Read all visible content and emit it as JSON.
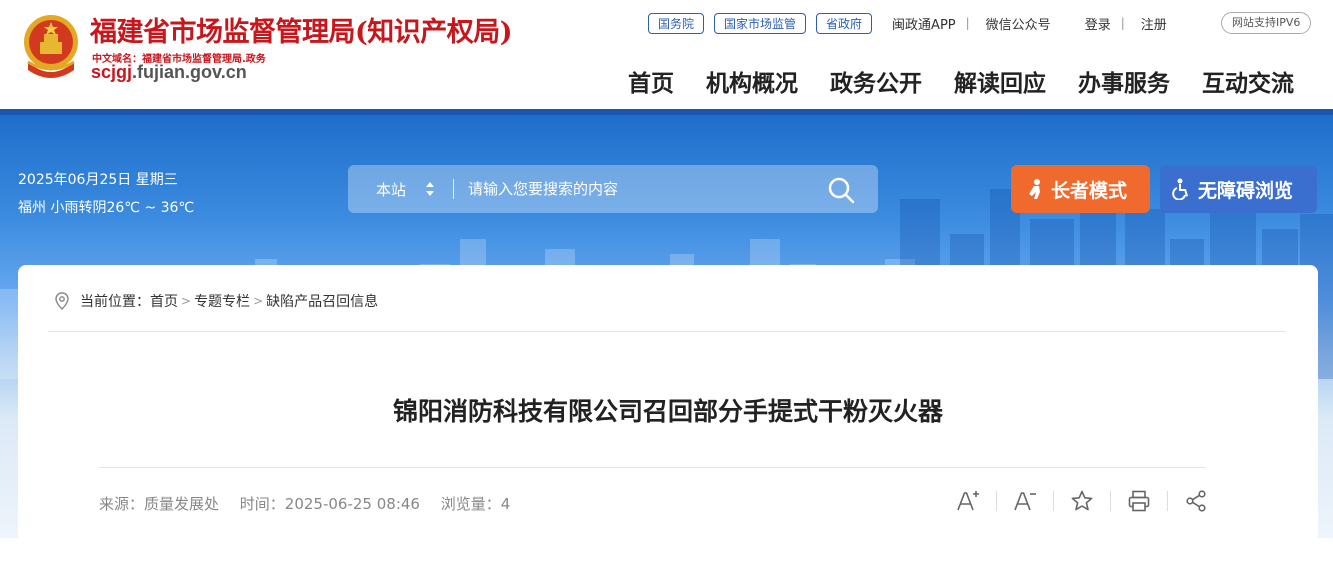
{
  "header": {
    "site_title": "福建省市场监督管理局(知识产权局)",
    "cn_domain": "中文域名：福建省市场监督管理局.政务",
    "en_domain_hl": "scjgj",
    "en_domain_rest": ".fujian.gov.cn",
    "top_pills": [
      "国务院",
      "国家市场监管",
      "省政府"
    ],
    "app_link": "闽政通APP",
    "wechat_link": "微信公众号",
    "login": "登录",
    "register": "注册",
    "ipv6_badge": "网站支持IPV6",
    "nav": [
      "首页",
      "机构概况",
      "政务公开",
      "解读回应",
      "办事服务",
      "互动交流"
    ]
  },
  "banner": {
    "date": "2025年06月25日 星期三",
    "weather": "福州 小雨转阴26℃ ~ 36℃",
    "search_scope": "本站",
    "search_placeholder": "请输入您要搜索的内容",
    "elder_mode": "长者模式",
    "accessible": "无障碍浏览"
  },
  "breadcrumb": {
    "label": "当前位置：",
    "items": [
      "首页",
      "专题专栏",
      "缺陷产品召回信息"
    ],
    "arrow": ">"
  },
  "article": {
    "title": "锦阳消防科技有限公司召回部分手提式干粉灭火器",
    "source": "来源：质量发展处",
    "time": "时间：2025-06-25 08:46",
    "views": "浏览量：4"
  },
  "colors": {
    "brand_red": "#c8161d",
    "nav_blue": "#2c5fb4",
    "elder_orange": "#ef6a2c",
    "access_blue": "#3a6fcf"
  },
  "icons": [
    "emblem-icon",
    "sort-caret-icon",
    "search-icon",
    "elder-icon",
    "wheelchair-icon",
    "location-pin-icon",
    "font-increase-icon",
    "font-decrease-icon",
    "star-icon",
    "print-icon",
    "share-icon"
  ]
}
